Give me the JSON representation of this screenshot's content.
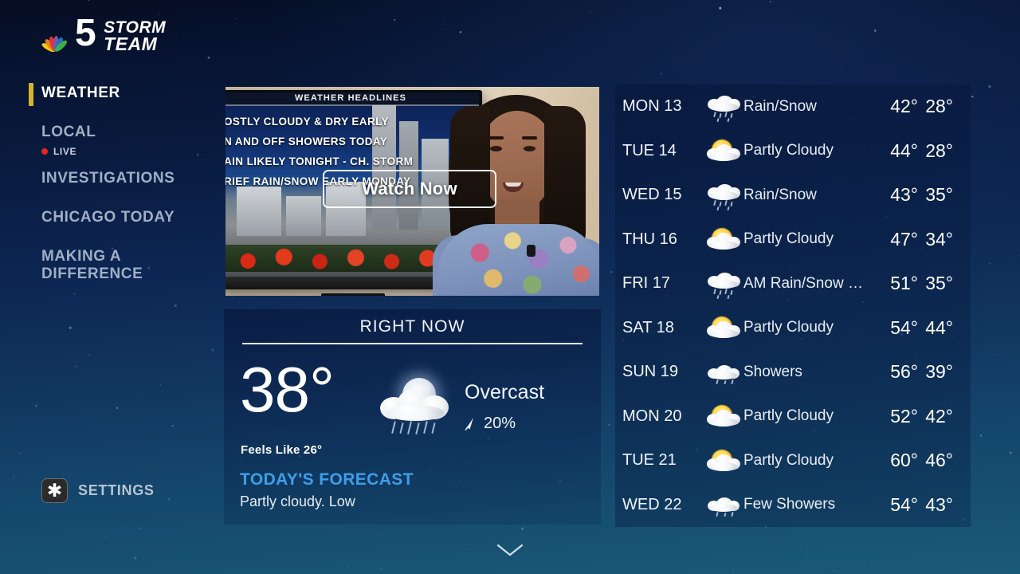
{
  "brand": {
    "channel_number": "5",
    "storm": "STORM",
    "team": "TEAM",
    "logo_icon": "nbc-peacock-icon"
  },
  "sidebar": {
    "items": [
      {
        "label": "WEATHER",
        "active": true
      },
      {
        "label": "LOCAL",
        "active": false,
        "badge": "LIVE"
      },
      {
        "label": "INVESTIGATIONS",
        "active": false
      },
      {
        "label": "CHICAGO TODAY",
        "active": false
      },
      {
        "label": "MAKING A DIFFERENCE",
        "active": false
      }
    ],
    "settings": {
      "label": "SETTINGS",
      "icon": "asterisk-icon"
    }
  },
  "video": {
    "watch_button": "Watch Now",
    "headline_title": "WEATHER HEADLINES",
    "headlines": [
      "OSTLY CLOUDY & DRY EARLY",
      "N AND OFF SHOWERS TODAY",
      "AIN LIKELY TONIGHT - CH. STORM",
      "RIEF RAIN/SNOW EARLY MONDAY"
    ]
  },
  "right_now": {
    "title": "RIGHT NOW",
    "temperature": "38°",
    "feels_like": "Feels Like 26°",
    "condition": "Overcast",
    "precip_chance": "20%",
    "precip_icon": "raindrop-icon",
    "condition_icon": "moon-cloud-rain-icon",
    "forecast_heading": "TODAY'S FORECAST",
    "forecast_text": "Partly cloudy. Low"
  },
  "forecast": {
    "rows": [
      {
        "day": "MON 13",
        "condition": "Rain/Snow",
        "icon": "cloud-rain-snow-icon",
        "high": "42°",
        "low": "28°"
      },
      {
        "day": "TUE 14",
        "condition": "Partly Cloudy",
        "icon": "sun-cloud-icon",
        "high": "44°",
        "low": "28°"
      },
      {
        "day": "WED 15",
        "condition": "Rain/Snow",
        "icon": "cloud-rain-snow-icon",
        "high": "43°",
        "low": "35°"
      },
      {
        "day": "THU 16",
        "condition": "Partly Cloudy",
        "icon": "sun-cloud-icon",
        "high": "47°",
        "low": "34°"
      },
      {
        "day": "FRI 17",
        "condition": "AM Rain/Snow Sho...",
        "icon": "cloud-rain-snow-icon",
        "high": "51°",
        "low": "35°"
      },
      {
        "day": "SAT 18",
        "condition": "Partly Cloudy",
        "icon": "sun-cloud-icon",
        "high": "54°",
        "low": "44°"
      },
      {
        "day": "SUN 19",
        "condition": "Showers",
        "icon": "cloud-showers-icon",
        "high": "56°",
        "low": "39°"
      },
      {
        "day": "MON 20",
        "condition": "Partly Cloudy",
        "icon": "sun-cloud-icon",
        "high": "52°",
        "low": "42°"
      },
      {
        "day": "TUE 21",
        "condition": "Partly Cloudy",
        "icon": "sun-cloud-icon",
        "high": "60°",
        "low": "46°"
      },
      {
        "day": "WED 22",
        "condition": "Few Showers",
        "icon": "cloud-showers-icon",
        "high": "54°",
        "low": "43°"
      }
    ]
  },
  "footer": {
    "scroll_hint_icon": "chevron-down-icon"
  },
  "colors": {
    "accent_yellow": "#d7b52b",
    "live_red": "#e8231d",
    "forecast_blue": "#3f9ee8",
    "text_primary": "#ffffff",
    "text_muted": "#9fb0c6"
  }
}
